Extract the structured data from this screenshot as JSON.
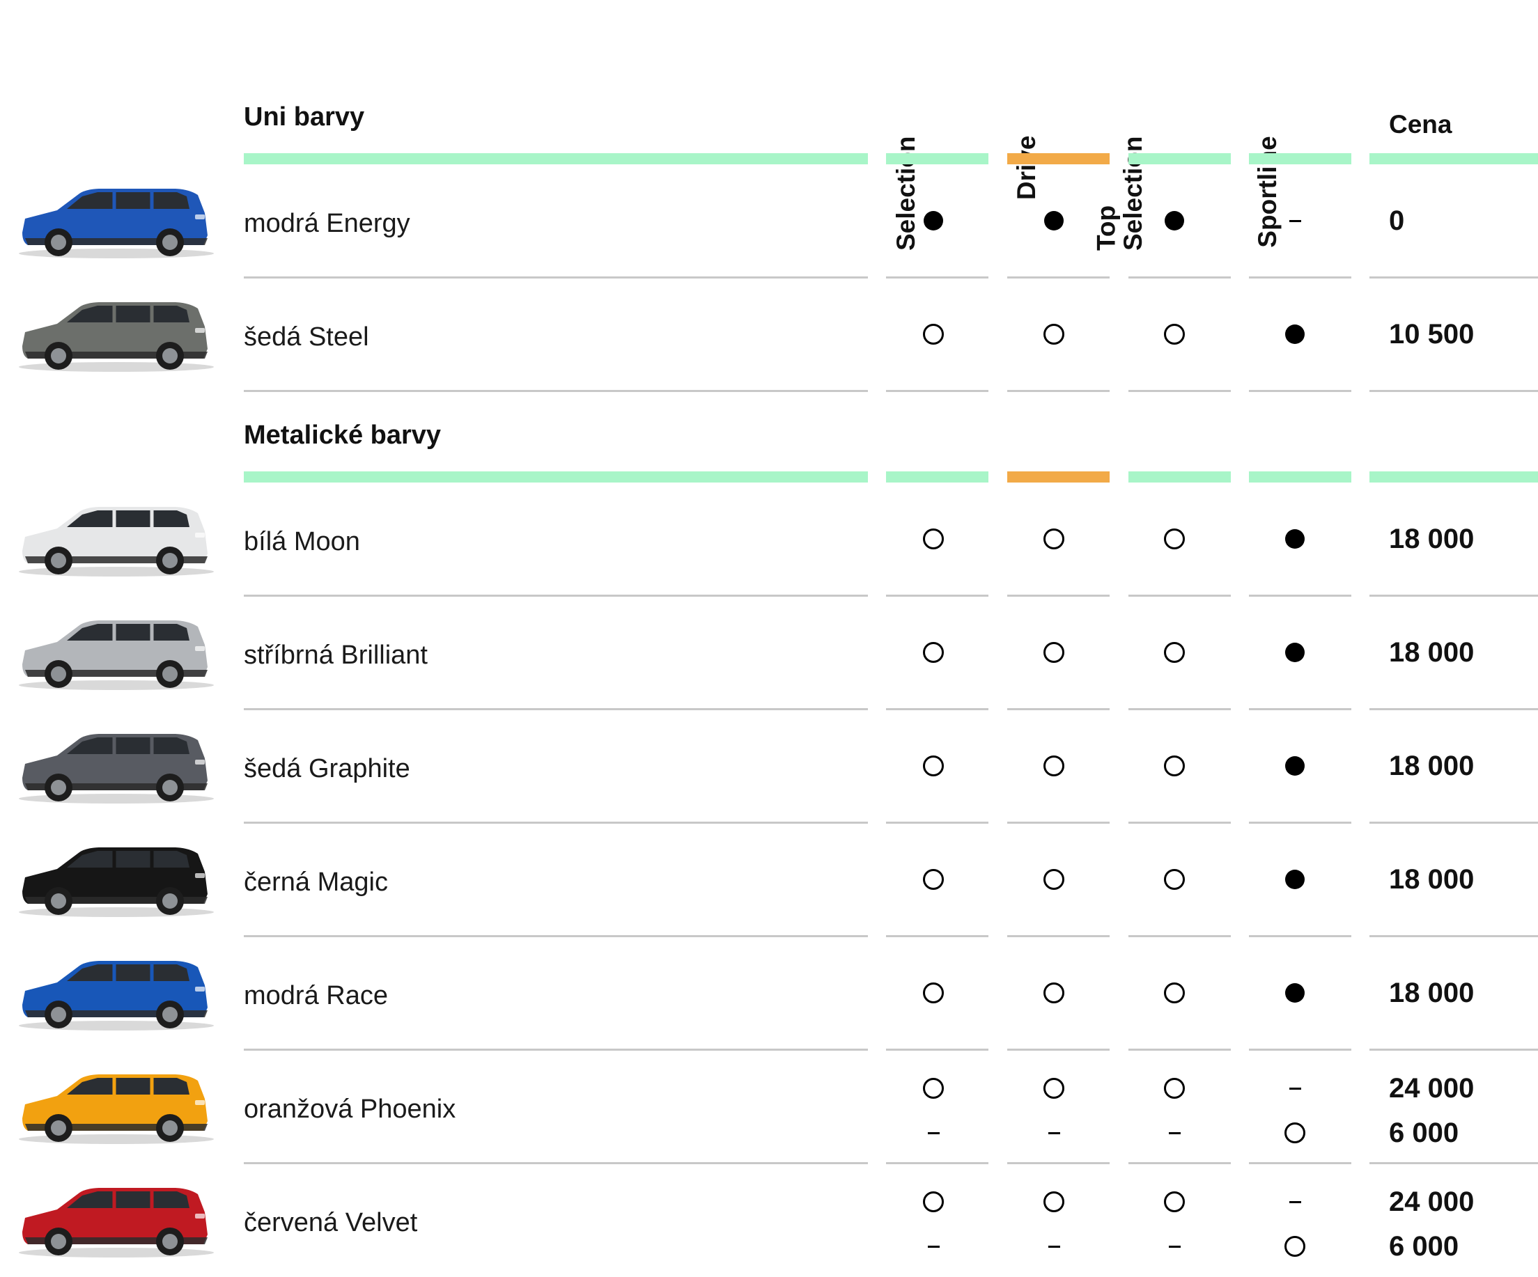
{
  "columns": [
    "Selection",
    "Drive",
    "Top Selection",
    "Sportline"
  ],
  "columns_lines": [
    [
      "Selection"
    ],
    [
      "Drive"
    ],
    [
      "Top",
      "Selection"
    ],
    [
      "Sportline"
    ]
  ],
  "price_header": "Cena",
  "colors": {
    "bar_green": "#a8f5c8",
    "bar_orange": "#f2aa48",
    "rule_gray": "#c8c8c8"
  },
  "sections": [
    {
      "title": "Uni barvy",
      "rows": [
        {
          "label": "modrá Energy",
          "car_color": "#1f57b8",
          "lines": [
            {
              "marks": [
                "full",
                "full",
                "full",
                "dash"
              ],
              "price": "0"
            }
          ]
        },
        {
          "label": "šedá Steel",
          "car_color": "#6c6f6b",
          "lines": [
            {
              "marks": [
                "open",
                "open",
                "open",
                "full"
              ],
              "price": "10 500"
            }
          ]
        }
      ]
    },
    {
      "title": "Metalické barvy",
      "rows": [
        {
          "label": "bílá Moon",
          "car_color": "#e6e7e8",
          "lines": [
            {
              "marks": [
                "open",
                "open",
                "open",
                "full"
              ],
              "price": "18 000"
            }
          ]
        },
        {
          "label": "stříbrná Brilliant",
          "car_color": "#b3b6ba",
          "lines": [
            {
              "marks": [
                "open",
                "open",
                "open",
                "full"
              ],
              "price": "18 000"
            }
          ]
        },
        {
          "label": "šedá Graphite",
          "car_color": "#585b62",
          "lines": [
            {
              "marks": [
                "open",
                "open",
                "open",
                "full"
              ],
              "price": "18 000"
            }
          ]
        },
        {
          "label": "černá Magic",
          "car_color": "#161616",
          "lines": [
            {
              "marks": [
                "open",
                "open",
                "open",
                "full"
              ],
              "price": "18 000"
            }
          ]
        },
        {
          "label": "modrá Race",
          "car_color": "#1857b8",
          "lines": [
            {
              "marks": [
                "open",
                "open",
                "open",
                "full"
              ],
              "price": "18 000"
            }
          ]
        },
        {
          "label": "oranžová Phoenix",
          "car_color": "#f2a110",
          "lines": [
            {
              "marks": [
                "open",
                "open",
                "open",
                "dash"
              ],
              "price": "24 000"
            },
            {
              "marks": [
                "dash",
                "dash",
                "dash",
                "open"
              ],
              "price": "6 000"
            }
          ]
        },
        {
          "label": "červená Velvet",
          "car_color": "#c01a22",
          "lines": [
            {
              "marks": [
                "open",
                "open",
                "open",
                "dash"
              ],
              "price": "24 000"
            },
            {
              "marks": [
                "dash",
                "dash",
                "dash",
                "open"
              ],
              "price": "6 000"
            }
          ]
        }
      ]
    }
  ]
}
